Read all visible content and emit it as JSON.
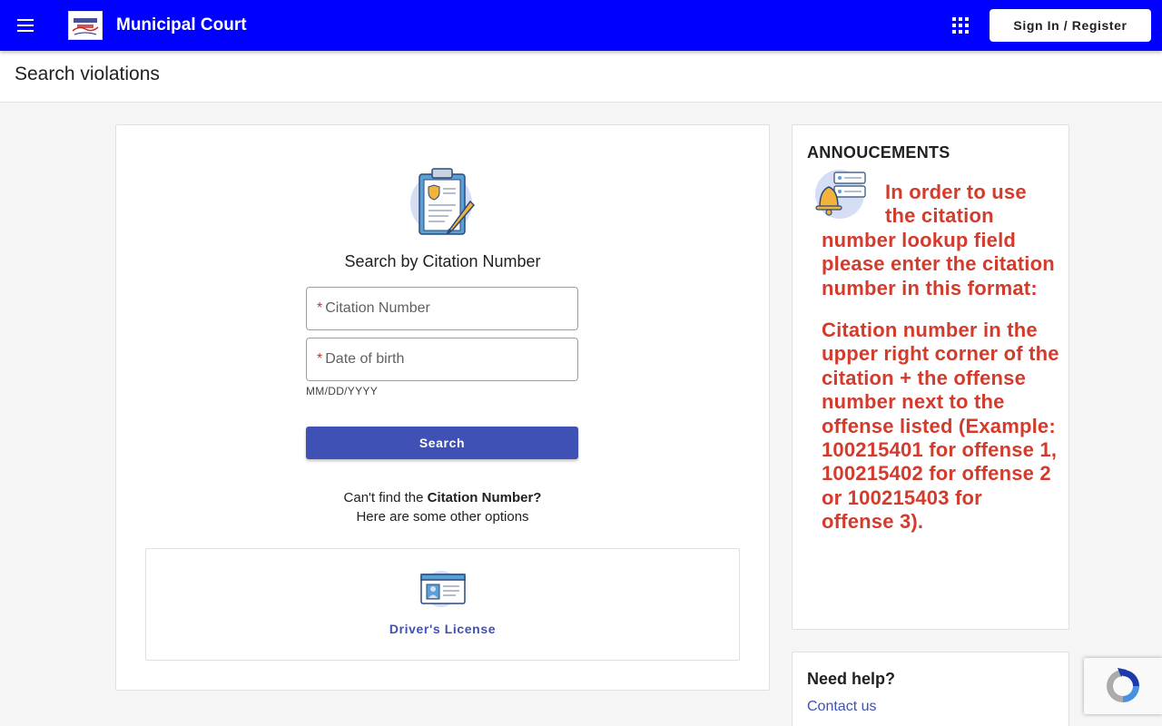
{
  "header": {
    "app_title": "Municipal Court",
    "signin_label": "Sign In / Register",
    "brand_color": "#0000ff",
    "icons": [
      "menu-icon",
      "apps-grid-icon"
    ]
  },
  "page": {
    "title": "Search violations"
  },
  "search": {
    "title": "Search by Citation Number",
    "citation_placeholder": "Citation Number",
    "dob_placeholder": "Date of birth",
    "dob_hint": "MM/DD/YYYY",
    "search_label": "Search",
    "cant_find_prefix": "Can't find the ",
    "cant_find_bold": "Citation Number?",
    "other_options": "Here are some other options",
    "options": [
      {
        "label": "Driver's License",
        "icon": "id-card-icon"
      }
    ],
    "accent_color": "#3f51b5"
  },
  "announcements": {
    "title": "ANNOUCEMENTS",
    "paragraphs": [
      "In order to use the citation number lookup field please enter the citation number in this format:",
      "Citation number in the upper right corner of the citation + the offense number next to the offense listed (Example: 100215401 for offense 1, 100215402 for offense 2 or 100215403 for offense 3)."
    ],
    "text_color": "#d33b2c"
  },
  "help": {
    "title": "Need help?",
    "contact_label": "Contact us"
  }
}
